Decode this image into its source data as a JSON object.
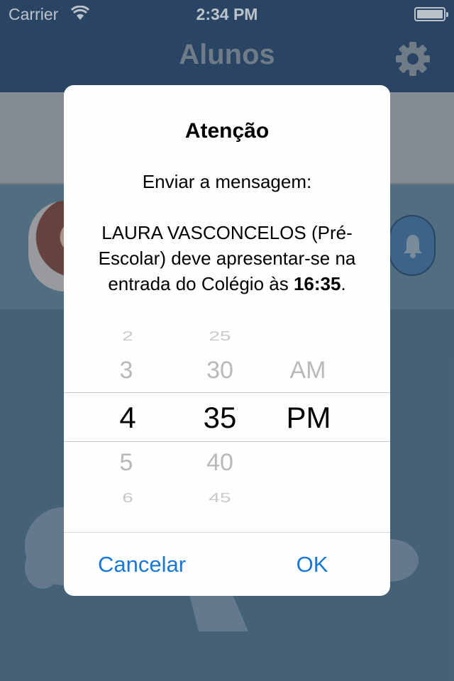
{
  "status": {
    "carrier": "Carrier",
    "time": "2:34 PM"
  },
  "nav": {
    "title": "Alunos"
  },
  "alert": {
    "title": "Atenção",
    "message_intro": "Enviar a mensagem:",
    "message_body_1": "LAURA VASCONCELOS (Pré-",
    "message_body_2": "Escolar) deve apresentar-se na",
    "message_body_3": "entrada do Colégio às ",
    "message_time": "16:35",
    "message_end": ".",
    "cancel_label": "Cancelar",
    "ok_label": "OK"
  },
  "picker": {
    "hours": [
      "2",
      "3",
      "4",
      "5",
      "6"
    ],
    "minutes": [
      "25",
      "30",
      "35",
      "40",
      "45"
    ],
    "period": [
      "AM",
      "PM"
    ],
    "selected_hour": "4",
    "selected_minute": "35",
    "selected_period": "PM"
  },
  "colors": {
    "navbar": "#203f63",
    "accent": "#1779d6",
    "background": "#4b6b83"
  }
}
